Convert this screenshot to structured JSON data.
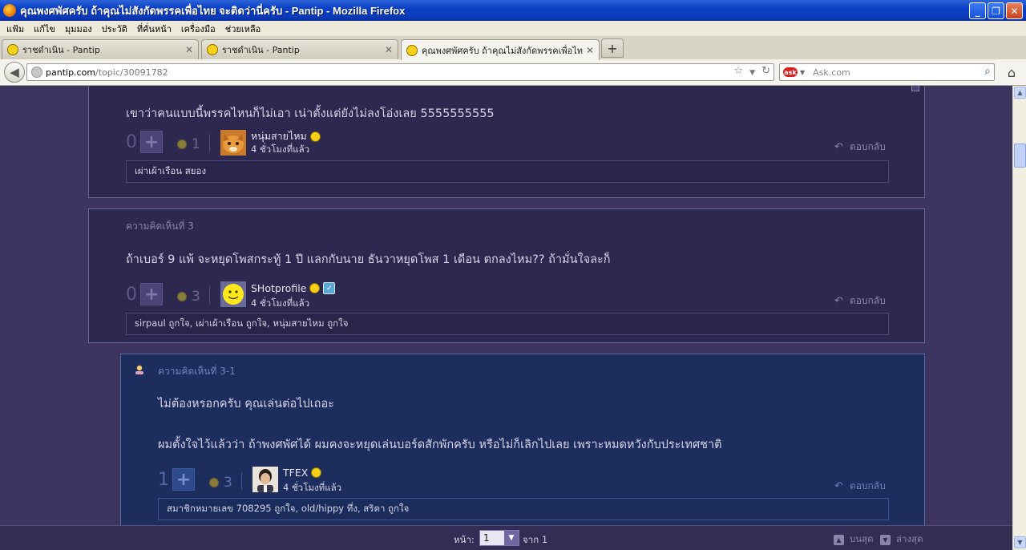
{
  "window": {
    "title": "คุณพงศพัศครับ ถ้าคุณไม่สังกัดพรรคเพื่อไทย จะติดว่านี่ครับ - Pantip - Mozilla Firefox"
  },
  "menu": [
    "แฟ้ม",
    "แก้ไข",
    "มุมมอง",
    "ประวัติ",
    "ที่คั่นหน้า",
    "เครื่องมือ",
    "ช่วยเหลือ"
  ],
  "tabs": [
    {
      "label": "ราชดำเนิน - Pantip"
    },
    {
      "label": "ราชดำเนิน - Pantip"
    },
    {
      "label": "คุณพงศพัศครับ ถ้าคุณไม่สังกัดพรรคเพื่อไท..."
    }
  ],
  "nav": {
    "url_host": "pantip.com",
    "url_path": "/topic/30091782",
    "search_placeholder": "Ask.com"
  },
  "comments": [
    {
      "number_label": "",
      "body": [
        "เขาว่าคนแบบนี้พรรคไหนก็ไม่เอา เน่าตั้งแต่ยังไม่ลงโอ่งเลย 5555555555"
      ],
      "votes": "0",
      "emotions": "1",
      "user": "หนุ่มสายไหม",
      "time": "4 ชั่วโมงที่แล้ว",
      "reply_label": "ตอบกลับ",
      "likes": "เผ่าเผ้าเรือน สยอง"
    },
    {
      "number_label": "ความคิดเห็นที่ 3",
      "body": [
        "ถ้าเบอร์ 9  แพ้  จะหยุดโพสกระทู้ 1 ปี แลกกับนาย ธันวาหยุดโพส  1 เดือน  ตกลงไหม?? ถ้ามั่นใจละก็"
      ],
      "votes": "0",
      "emotions": "3",
      "user": "SHotprofile",
      "time": "4 ชั่วโมงที่แล้ว",
      "reply_label": "ตอบกลับ",
      "likes": "sirpaul ถูกใจ, เผ่าเผ้าเรือน ถูกใจ, หนุ่มสายไหม ถูกใจ"
    },
    {
      "number_label": "ความคิดเห็นที่ 3-1",
      "body": [
        "ไม่ต้องหรอกครับ คุณเล่นต่อไปเถอะ",
        "ผมตั้งใจไว้แล้วว่า ถ้าพงศพัศได้ ผมคงจะหยุดเล่นบอร์ดสักพักครับ หรือไม่ก็เลิกไปเลย เพราะหมดหวังกับประเทศชาติ"
      ],
      "votes": "1",
      "emotions": "3",
      "user": "TFEX",
      "time": "4 ชั่วโมงที่แล้ว",
      "reply_label": "ตอบกลับ",
      "likes": "สมาชิกหมายเลข 708295 ถูกใจ, old/hippy ทึ่ง, สริตา ถูกใจ"
    }
  ],
  "pager": {
    "page_label": "หน้า:",
    "page_value": "1",
    "of_label": "จาก 1",
    "top_label": "บนสุด",
    "bottom_label": "ล่างสุด"
  },
  "colors": {
    "page_bg": "#3d3560",
    "card_bg": "#2d2850",
    "reply_card_bg": "#1c2d5e",
    "titlebar": "#0a3fc4"
  }
}
